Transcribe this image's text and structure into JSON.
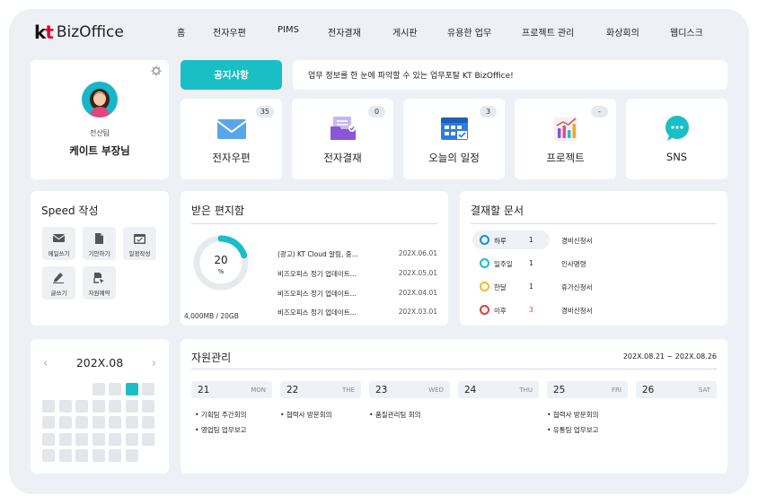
{
  "header": {
    "logo_text": "BizOffice",
    "logo_mark_k": "k",
    "logo_mark_t": "t",
    "nav": [
      "홈",
      "전자우편",
      "PIMS",
      "전자결재",
      "게시판",
      "유용한 업무",
      "프로젝트 관리",
      "화상회의",
      "웹디스크"
    ]
  },
  "profile": {
    "dept": "전산팀",
    "name": "케이트 부장님",
    "settings_icon": "gear-icon"
  },
  "notice": {
    "button": "공지사항",
    "message": "업무 정보를 한 눈에 파악할 수 있는 업무포탈 KT BizOffice!"
  },
  "tiles": [
    {
      "label": "전자우편",
      "badge": "35",
      "icon": "mail-icon"
    },
    {
      "label": "전자결재",
      "badge": "0",
      "icon": "approval-folder-icon"
    },
    {
      "label": "오늘의 일정",
      "badge": "3",
      "icon": "calendar-check-icon"
    },
    {
      "label": "프로젝트",
      "badge": "-",
      "icon": "chart-icon"
    },
    {
      "label": "SNS",
      "badge": "",
      "icon": "chat-bubble-icon"
    }
  ],
  "speed": {
    "title": "Speed 작성",
    "buttons": [
      {
        "label": "메일쓰기",
        "icon": "mail-icon"
      },
      {
        "label": "기안하기",
        "icon": "document-icon"
      },
      {
        "label": "일정작성",
        "icon": "calendar-icon"
      },
      {
        "label": "글쓰기",
        "icon": "pen-icon"
      },
      {
        "label": "자원예약",
        "icon": "reserve-icon"
      }
    ]
  },
  "inbox": {
    "title": "받은 편지함",
    "usage_value": "20",
    "usage_unit": "%",
    "usage_fraction": 0.2,
    "storage": "4,000MB / 20GB",
    "mails": [
      {
        "subject": "(광고) KT Cloud 알림, 중...",
        "date": "202X.06.01"
      },
      {
        "subject": "비즈오피스 정기 업데이트...",
        "date": "202X.05.01"
      },
      {
        "subject": "비즈오피스 정기 업데이트...",
        "date": "202X.04.01"
      },
      {
        "subject": "비즈오피스 정기 업데이트...",
        "date": "202X.03.01"
      }
    ]
  },
  "approval": {
    "title": "결재할 문서",
    "rows": [
      {
        "label": "하루",
        "count": "1",
        "doc": "경비신청서",
        "color": "#1a8fd6",
        "count_color": "#222222"
      },
      {
        "label": "일주일",
        "count": "1",
        "doc": "인사명령",
        "color": "#19bfc4",
        "count_color": "#222222"
      },
      {
        "label": "한달",
        "count": "1",
        "doc": "휴가신청서",
        "color": "#f5b731",
        "count_color": "#222222"
      },
      {
        "label": "이후",
        "count": "3",
        "doc": "경비신청서",
        "color": "#e63a3a",
        "count_color": "#e63a3a"
      }
    ]
  },
  "calendar": {
    "title": "202X.08",
    "prev": "‹",
    "next": "›"
  },
  "resource": {
    "title": "자원관리",
    "range": "202X.08.21 ~ 202X.08.26",
    "days": [
      {
        "num": "21",
        "wd": "MON",
        "events": [
          "기획팀 주간회의",
          "영업팀 업무보고"
        ]
      },
      {
        "num": "22",
        "wd": "THE",
        "events": [
          "협력사 방문회의"
        ]
      },
      {
        "num": "23",
        "wd": "WED",
        "events": [
          "품질관리팀 회의"
        ]
      },
      {
        "num": "24",
        "wd": "THU",
        "events": []
      },
      {
        "num": "25",
        "wd": "FRI",
        "events": [
          "협력사 방문회의",
          "유통팀 업무보고"
        ]
      },
      {
        "num": "26",
        "wd": "SAT",
        "events": []
      }
    ]
  },
  "colors": {
    "accent": "#19bfc4",
    "background": "#edf1f5"
  }
}
